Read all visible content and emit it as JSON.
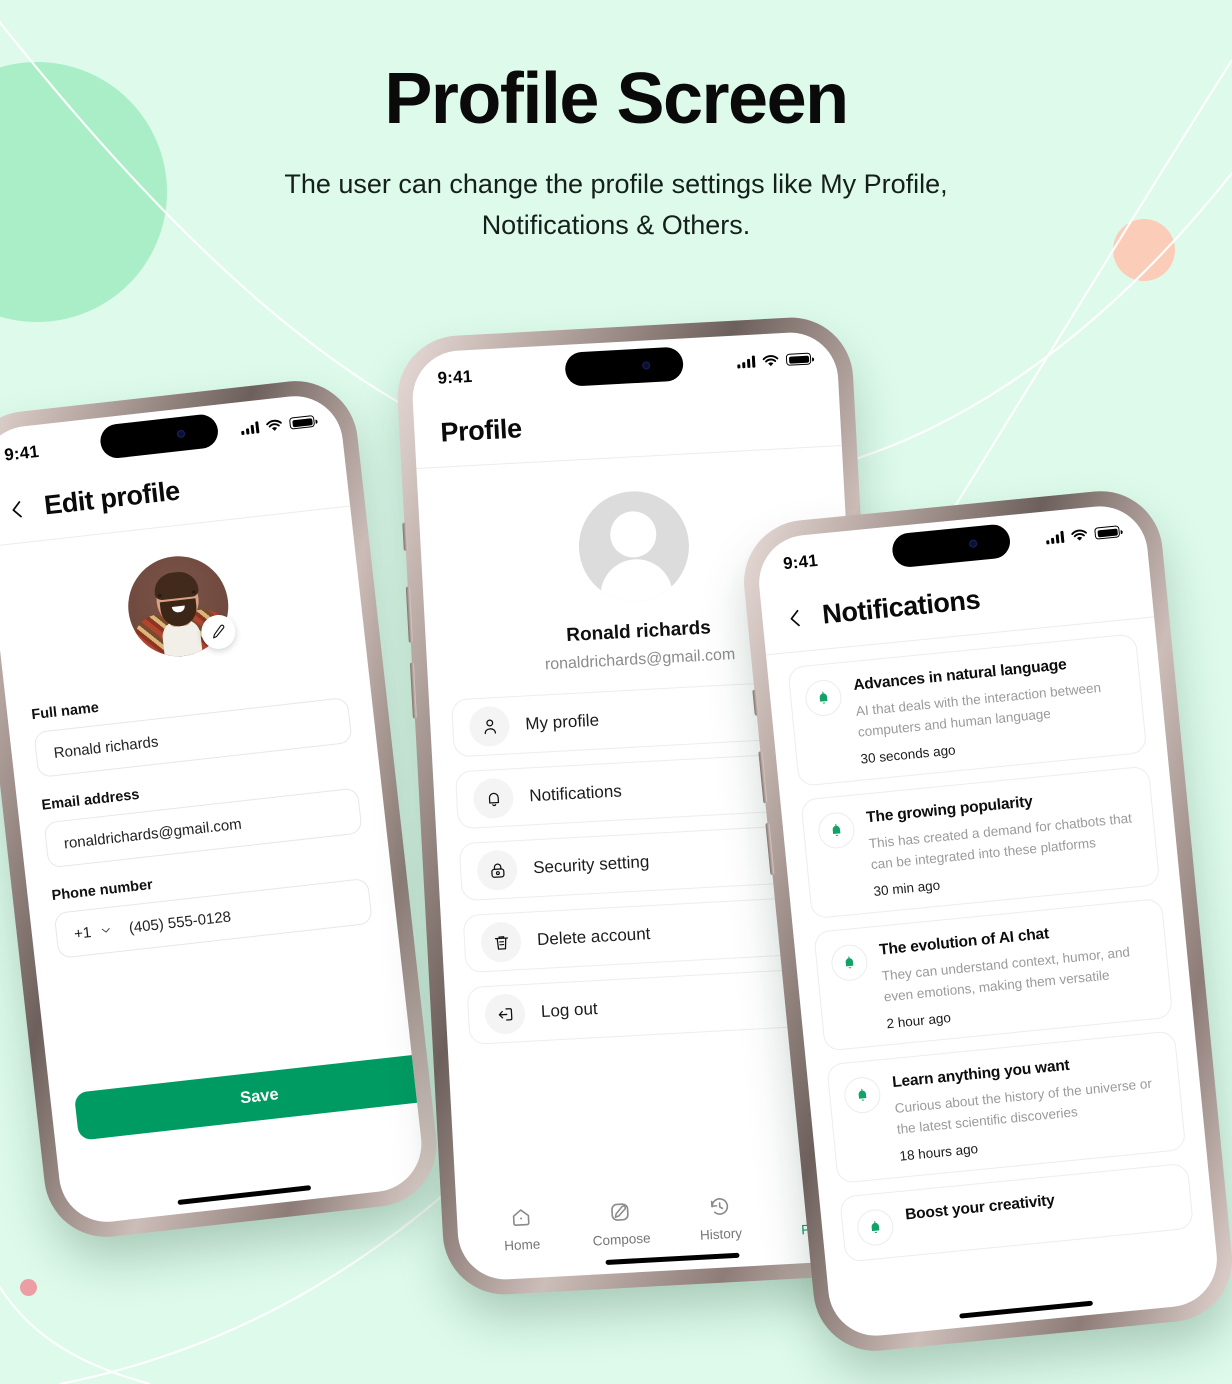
{
  "page": {
    "title": "Profile Screen",
    "subtitle": "The user can change the profile settings like My Profile, Notifications & Others.",
    "background_color": "#ddfaeb",
    "accent_color": "#009b62",
    "decor": {
      "green_circle_color": "#aaeec8",
      "peach_circle_color": "#fbccb8",
      "pink_dot_color": "#eb9fa4"
    }
  },
  "status_bar": {
    "time": "9:41",
    "signal_icon": "cellular-bars-icon",
    "wifi_icon": "wifi-icon",
    "battery_icon": "battery-icon"
  },
  "edit_profile_screen": {
    "back_icon": "chevron-left-icon",
    "title": "Edit profile",
    "avatar_alt": "user-photo",
    "edit_badge_icon": "pencil-icon",
    "fields": [
      {
        "label": "Full name",
        "value": "Ronald richards"
      },
      {
        "label": "Email address",
        "value": "ronaldrichards@gmail.com"
      }
    ],
    "phone_field": {
      "label": "Phone number",
      "country_code": "+1",
      "dropdown_icon": "chevron-down-icon",
      "value": "(405) 555-0128"
    },
    "save_label": "Save"
  },
  "profile_screen": {
    "title": "Profile",
    "avatar_icon": "person-placeholder-icon",
    "user_name": "Ronald richards",
    "user_email": "ronaldrichards@gmail.com",
    "menu": [
      {
        "label": "My profile",
        "icon": "user-icon",
        "chevron": "chevron-right-icon"
      },
      {
        "label": "Notifications",
        "icon": "bell-icon",
        "chevron": "chevron-right-icon"
      },
      {
        "label": "Security setting",
        "icon": "lock-icon",
        "chevron": "chevron-right-icon"
      },
      {
        "label": "Delete account",
        "icon": "trash-icon",
        "chevron": "chevron-right-icon"
      },
      {
        "label": "Log out",
        "icon": "logout-icon",
        "chevron": "chevron-right-icon"
      }
    ],
    "tabs": [
      {
        "label": "Home",
        "icon": "home-icon",
        "active": false
      },
      {
        "label": "Compose",
        "icon": "pencil-icon",
        "active": false
      },
      {
        "label": "History",
        "icon": "history-icon",
        "active": false
      },
      {
        "label": "Profile",
        "icon": "person-icon",
        "active": true
      }
    ]
  },
  "notifications_screen": {
    "back_icon": "chevron-left-icon",
    "title": "Notifications",
    "items": [
      {
        "icon": "bell-icon",
        "title": "Advances in natural language",
        "description": "AI that deals with the interaction between computers and human language",
        "time": "30 seconds ago"
      },
      {
        "icon": "bell-icon",
        "title": "The growing popularity",
        "description": "This has created a demand for chatbots that can be integrated into these platforms",
        "time": "30 min ago"
      },
      {
        "icon": "bell-icon",
        "title": "The evolution of AI chat",
        "description": "They can understand context, humor, and even emotions, making them versatile",
        "time": "2 hour ago"
      },
      {
        "icon": "bell-icon",
        "title": "Learn anything you want",
        "description": "Curious about the history of the universe or the latest scientific discoveries",
        "time": "18 hours ago"
      },
      {
        "icon": "bell-icon",
        "title": "Boost your creativity",
        "description": "",
        "time": ""
      }
    ]
  }
}
